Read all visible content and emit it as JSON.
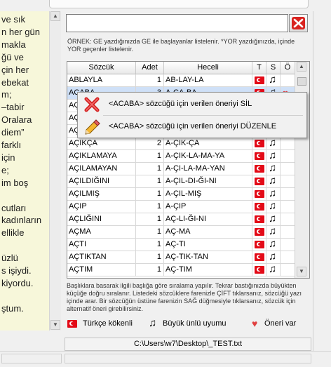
{
  "left_text": {
    "lines": [
      "ve sık",
      "n her gün",
      "makla",
      "ğü ve",
      "çin her",
      "ebekat",
      "m;",
      "  –tabir",
      "Oralara",
      "diem”",
      "farklı",
      "için",
      "e;",
      "im boş",
      "",
      "cutları",
      "kadınların",
      "ellikle",
      "",
      "üzlü",
      "s işiydi.",
      "kiyordu.",
      "",
      "ştum."
    ]
  },
  "search": {
    "value": "",
    "clear_label": "clear"
  },
  "hint_text": "ÖRNEK: GE yazdığınızda GE ile başlayanlar listelenir. *YOR yazdığınızda, içinde YOR geçenler listelenir.",
  "table": {
    "headers": {
      "word": "Sözcük",
      "count": "Adet",
      "syllables": "Heceli",
      "t": "T",
      "s": "S",
      "o": "Ö"
    },
    "rows": [
      {
        "word": "ABLAYLA",
        "count": "1",
        "syllables": "AB-LAY-LA",
        "t": true,
        "s": true,
        "o": false
      },
      {
        "word": "ACABA",
        "count": "3",
        "syllables": "A-CA-BA",
        "t": true,
        "s": true,
        "o": true,
        "selected": true
      },
      {
        "word": "AÇ",
        "count": "",
        "syllables": "",
        "t": true,
        "s": true,
        "o": false
      },
      {
        "word": "AÇ",
        "count": "",
        "syllables": "",
        "t": true,
        "s": true,
        "o": false
      },
      {
        "word": "AÇ",
        "count": "",
        "syllables": "",
        "t": true,
        "s": true,
        "o": false
      },
      {
        "word": "AÇIKÇA",
        "count": "2",
        "syllables": "A-ÇIK-ÇA",
        "t": true,
        "s": true,
        "o": false
      },
      {
        "word": "AÇIKLAMAYA",
        "count": "1",
        "syllables": "A-ÇIK-LA-MA-YA",
        "t": true,
        "s": true,
        "o": false
      },
      {
        "word": "AÇILAMAYAN",
        "count": "1",
        "syllables": "A-ÇI-LA-MA-YAN",
        "t": true,
        "s": true,
        "o": false
      },
      {
        "word": "AÇILDIĞINI",
        "count": "1",
        "syllables": "A-ÇIL-DI-ĞI-NI",
        "t": true,
        "s": true,
        "o": false
      },
      {
        "word": "AÇILMIŞ",
        "count": "1",
        "syllables": "A-ÇIL-MIŞ",
        "t": true,
        "s": true,
        "o": false
      },
      {
        "word": "AÇIP",
        "count": "1",
        "syllables": "A-ÇIP",
        "t": true,
        "s": true,
        "o": false
      },
      {
        "word": "AÇLIĞINI",
        "count": "1",
        "syllables": "AÇ-LI-ĞI-NI",
        "t": true,
        "s": true,
        "o": false
      },
      {
        "word": "AÇMA",
        "count": "1",
        "syllables": "AÇ-MA",
        "t": true,
        "s": true,
        "o": false
      },
      {
        "word": "AÇTI",
        "count": "1",
        "syllables": "AÇ-TI",
        "t": true,
        "s": true,
        "o": false
      },
      {
        "word": "AÇTIKTAN",
        "count": "1",
        "syllables": "AÇ-TIK-TAN",
        "t": true,
        "s": true,
        "o": false
      },
      {
        "word": "AÇTIM",
        "count": "1",
        "syllables": "AÇ-TIM",
        "t": true,
        "s": true,
        "o": false
      }
    ]
  },
  "context_menu": {
    "delete_label": "<ACABA> sözcüğü için verilen öneriyi SİL",
    "edit_label": "<ACABA> sözcüğü için verilen öneriyi DÜZENLE"
  },
  "help_text": "Başlıklara basarak ilgili başlığa göre sıralama yapılır. Tekrar bastığınızda büyükten küçüğe doğru sıralanır. Listedeki sözcüklere farenizle ÇİFT tıklarsanız, sözcüğü yazı içinde arar. Bir sözcüğün üstüne farenizin SAĞ düğmesiyle tıklarsanız, sözcük için alternatif öneri girebilirsiniz.",
  "legend": {
    "turkish": "Türkçe kökenli",
    "vowel": "Büyük ünlü uyumu",
    "suggestion": "Öneri var"
  },
  "file_path": "C:\\Users\\w7\\Desktop\\_TEST.txt",
  "colors": {
    "flag": "#e30a17",
    "heart": "#e04040",
    "clear_button": "#d9231f",
    "selection": "#cfe0f7"
  },
  "icons": {
    "clear": "x-icon",
    "delete": "red-x-icon",
    "edit": "pencil-icon",
    "flag": "turkish-flag-icon",
    "note": "music-note-icon",
    "heart": "heart-icon"
  }
}
